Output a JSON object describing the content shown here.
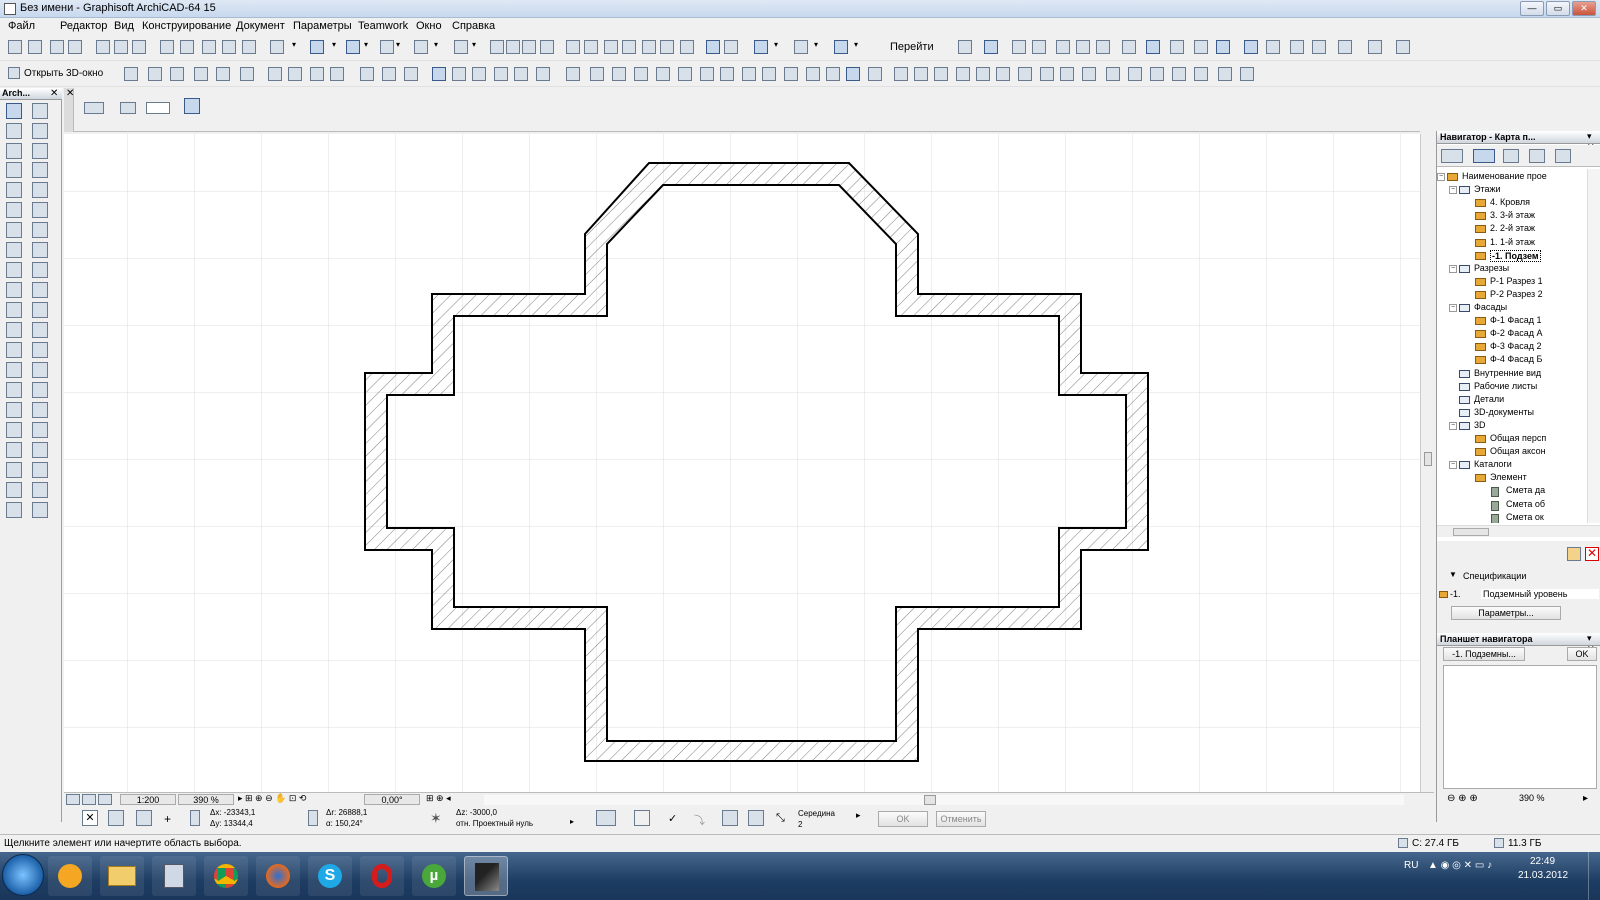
{
  "window": {
    "title": "Без имени - Graphisoft ArchiCAD-64 15",
    "min": "—",
    "max": "▭",
    "close": "✕"
  },
  "menu": [
    "Файл",
    "Редактор",
    "Вид",
    "Конструирование",
    "Документ",
    "Параметры",
    "Teamwork",
    "Окно",
    "Справка"
  ],
  "toolbar": {
    "goto_label": "Перейти",
    "open3d_label": "Открыть 3D-окно"
  },
  "toolbox": {
    "title": "Arch..."
  },
  "navigator": {
    "title": "Навигатор - Карта п...",
    "tree": [
      {
        "level": 0,
        "label": "Наименование прое",
        "icon": "project-icon"
      },
      {
        "level": 1,
        "label": "Этажи",
        "icon": "stories-icon"
      },
      {
        "level": 2,
        "label": "4. Кровля",
        "icon": "story-icon"
      },
      {
        "level": 2,
        "label": "3. 3-й этаж",
        "icon": "story-icon"
      },
      {
        "level": 2,
        "label": "2. 2-й этаж",
        "icon": "story-icon"
      },
      {
        "level": 2,
        "label": "1. 1-й этаж",
        "icon": "story-icon"
      },
      {
        "level": 2,
        "label": "-1. Подзем",
        "icon": "story-icon",
        "selected": true
      },
      {
        "level": 1,
        "label": "Разрезы",
        "icon": "section-icon"
      },
      {
        "level": 2,
        "label": "Р-1 Разрез 1",
        "icon": "section-item-icon"
      },
      {
        "level": 2,
        "label": "Р-2 Разрез 2",
        "icon": "section-item-icon"
      },
      {
        "level": 1,
        "label": "Фасады",
        "icon": "elevation-icon"
      },
      {
        "level": 2,
        "label": "Ф-1 Фасад 1",
        "icon": "elevation-item-icon"
      },
      {
        "level": 2,
        "label": "Ф-2 Фасад А",
        "icon": "elevation-item-icon"
      },
      {
        "level": 2,
        "label": "Ф-3 Фасад 2",
        "icon": "elevation-item-icon"
      },
      {
        "level": 2,
        "label": "Ф-4 Фасад Б",
        "icon": "elevation-item-icon"
      },
      {
        "level": 1,
        "label": "Внутренние вид",
        "icon": "interior-icon"
      },
      {
        "level": 1,
        "label": "Рабочие листы",
        "icon": "worksheet-icon"
      },
      {
        "level": 1,
        "label": "Детали",
        "icon": "detail-icon"
      },
      {
        "level": 1,
        "label": "3D-документы",
        "icon": "3d-doc-icon"
      },
      {
        "level": 1,
        "label": "3D",
        "icon": "3d-icon"
      },
      {
        "level": 2,
        "label": "Общая персп",
        "icon": "perspective-icon"
      },
      {
        "level": 2,
        "label": "Общая аксон",
        "icon": "axon-icon"
      },
      {
        "level": 1,
        "label": "Каталоги",
        "icon": "catalog-icon"
      },
      {
        "level": 2,
        "label": "Элемент",
        "icon": "element-icon"
      },
      {
        "level": 3,
        "label": "Смета да",
        "icon": "schedule-icon"
      },
      {
        "level": 3,
        "label": "Смета об",
        "icon": "schedule-icon"
      },
      {
        "level": 3,
        "label": "Смета ок",
        "icon": "schedule-icon"
      }
    ],
    "spec_label": "Спецификации",
    "spec_num": "-1.",
    "spec_name": "Подземный уровень",
    "params_button": "Параметры..."
  },
  "planshet": {
    "title": "Планшет навигатора",
    "field": "-1. Подземны...",
    "ok": "OK",
    "zoom": "390 %"
  },
  "bottombar": {
    "scale": "1:200",
    "zoom": "390 %",
    "angle": "0,00°"
  },
  "coords": {
    "dx": "Δx: -23343,1",
    "dy": "Δy: 13344,4",
    "dr": "Δr: 26888,1",
    "da": "α: 150,24°",
    "dz": "Δz: -3000,0",
    "ref": "отн. Проектный нуль",
    "snap": "Середина",
    "snap_n": "2",
    "ok": "OK",
    "cancel": "Отменить"
  },
  "status": {
    "hint": "Щелкните элемент или начертите область выбора.",
    "disk_c": "C: 27.4 ГБ",
    "disk_d": "11.3 ГБ"
  },
  "taskbar": {
    "lang": "RU",
    "time": "22:49",
    "date": "21.03.2012"
  }
}
